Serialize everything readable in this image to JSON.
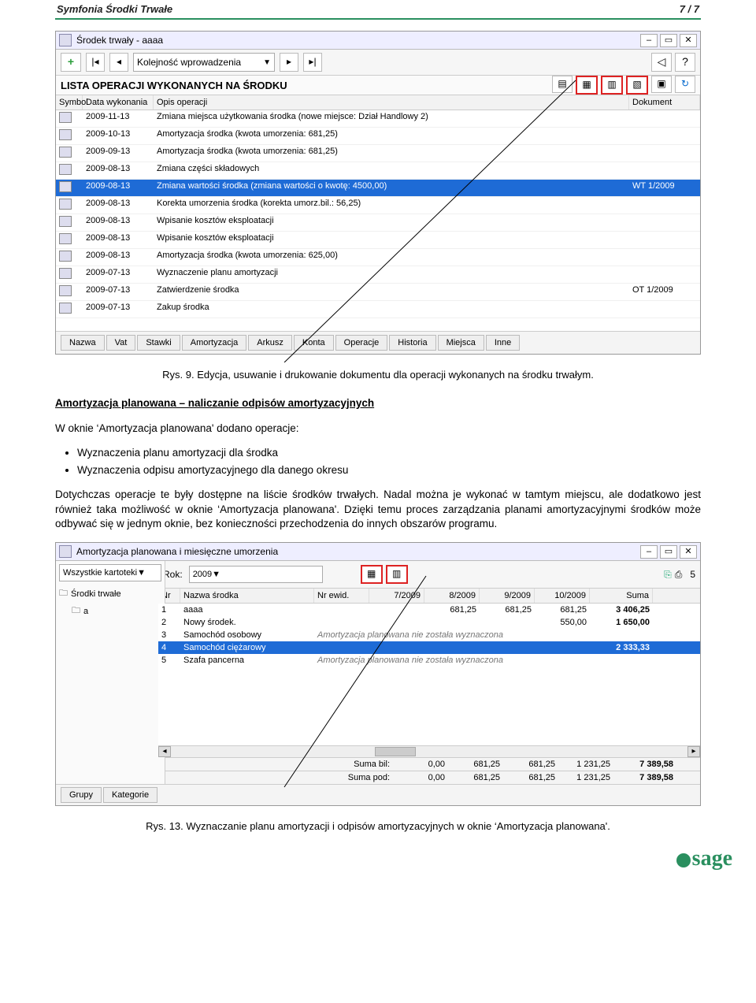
{
  "doc": {
    "header_left": "Symfonia Środki Trwałe",
    "header_right": "7 / 7",
    "caption1": "Rys. 9. Edycja, usuwanie i drukowanie dokumentu dla operacji wykonanych na środku trwałym.",
    "h1": "Amortyzacja planowana – naliczanie odpisów amortyzacyjnych",
    "p1": "W oknie ‘Amortyzacja planowana' dodano operacje:",
    "bullet1": "Wyznaczenia planu amortyzacji dla środka",
    "bullet2": "Wyznaczenia odpisu amortyzacyjnego dla danego okresu",
    "p2": "Dotychczas operacje te były dostępne na liście środków trwałych. Nadal można je wykonać w tamtym miejscu, ale dodatkowo jest również taka możliwość w oknie ‘Amortyzacja planowana'. Dzięki temu proces zarządzania planami amortyzacyjnymi środków może odbywać się w jednym oknie, bez konieczności przechodzenia do innych obszarów programu.",
    "caption2": "Rys. 13. Wyznaczanie planu amortyzacji i odpisów amortyzacyjnych w oknie ‘Amortyzacja planowana'."
  },
  "win1": {
    "title": "Środek trwały - aaaa",
    "combo": "Kolejność wprowadzenia",
    "section": "LISTA OPERACJI WYKONANYCH NA ŚRODKU",
    "cols": {
      "c1": "Symbol",
      "c2": "Data wykonania",
      "c3": "Opis operacji",
      "c4": "Dokument"
    },
    "rows": [
      {
        "d": "2009-11-13",
        "o": "Zmiana miejsca użytkowania środka (nowe miejsce: Dział Handlowy 2)",
        "k": ""
      },
      {
        "d": "2009-10-13",
        "o": "Amortyzacja środka (kwota umorzenia: 681,25)",
        "k": ""
      },
      {
        "d": "2009-09-13",
        "o": "Amortyzacja środka (kwota umorzenia: 681,25)",
        "k": ""
      },
      {
        "d": "2009-08-13",
        "o": "Zmiana części składowych",
        "k": ""
      },
      {
        "d": "2009-08-13",
        "o": "Zmiana wartości środka (zmiana wartości o kwotę: 4500,00)",
        "k": "WT 1/2009",
        "sel": true
      },
      {
        "d": "2009-08-13",
        "o": "Korekta umorzenia środka (korekta umorz.bil.: 56,25)",
        "k": ""
      },
      {
        "d": "2009-08-13",
        "o": "Wpisanie kosztów eksploatacji",
        "k": ""
      },
      {
        "d": "2009-08-13",
        "o": "Wpisanie kosztów eksploatacji",
        "k": ""
      },
      {
        "d": "2009-08-13",
        "o": "Amortyzacja środka (kwota umorzenia: 625,00)",
        "k": ""
      },
      {
        "d": "2009-07-13",
        "o": "Wyznaczenie planu amortyzacji",
        "k": ""
      },
      {
        "d": "2009-07-13",
        "o": "Zatwierdzenie środka",
        "k": "OT 1/2009"
      },
      {
        "d": "2009-07-13",
        "o": "Zakup środka",
        "k": ""
      }
    ],
    "tabs": [
      "Nazwa",
      "Vat",
      "Stawki",
      "Amortyzacja",
      "Arkusz",
      "Konta",
      "Operacje",
      "Historia",
      "Miejsca",
      "Inne"
    ]
  },
  "win2": {
    "title": "Amortyzacja planowana i miesięczne umorzenia",
    "filter": "Wszystkie kartoteki",
    "rok_label": "Rok:",
    "rok": "2009",
    "count": "5",
    "left_header": "Środki trwałe",
    "tree_item": "a",
    "cols": {
      "c1": "Nr",
      "c2": "Nazwa środka",
      "c3": "Nr ewid.",
      "c4": "7/2009",
      "c5": "8/2009",
      "c6": "9/2009",
      "c7": "10/2009",
      "c8": "Suma"
    },
    "rows": [
      {
        "n": "1",
        "nm": "aaaa",
        "e": "",
        "v4": "",
        "v5": "681,25",
        "v6": "681,25",
        "v7": "681,25",
        "s": "3 406,25"
      },
      {
        "n": "2",
        "nm": "Nowy środek.",
        "e": "",
        "v4": "",
        "v5": "",
        "v6": "",
        "v7": "550,00",
        "s": "1 650,00"
      },
      {
        "n": "3",
        "nm": "Samochód osobowy",
        "e": "",
        "note": "Amortyzacja planowana nie została wyznaczona"
      },
      {
        "n": "4",
        "nm": "Samochód ciężarowy",
        "e": "",
        "v4": "",
        "v5": "",
        "v6": "",
        "v7": "",
        "s": "2 333,33",
        "sel": true
      },
      {
        "n": "5",
        "nm": "Szafa pancerna",
        "e": "",
        "note": "Amortyzacja planowana nie została wyznaczona"
      }
    ],
    "sum": {
      "lbl1": "Suma bil:",
      "lbl2": "Suma pod:",
      "r1": [
        "0,00",
        "681,25",
        "681,25",
        "1 231,25",
        "7 389,58"
      ],
      "r2": [
        "0,00",
        "681,25",
        "681,25",
        "1 231,25",
        "7 389,58"
      ]
    },
    "bottom_tabs": [
      "Grupy",
      "Kategorie"
    ]
  },
  "logo": "sage"
}
